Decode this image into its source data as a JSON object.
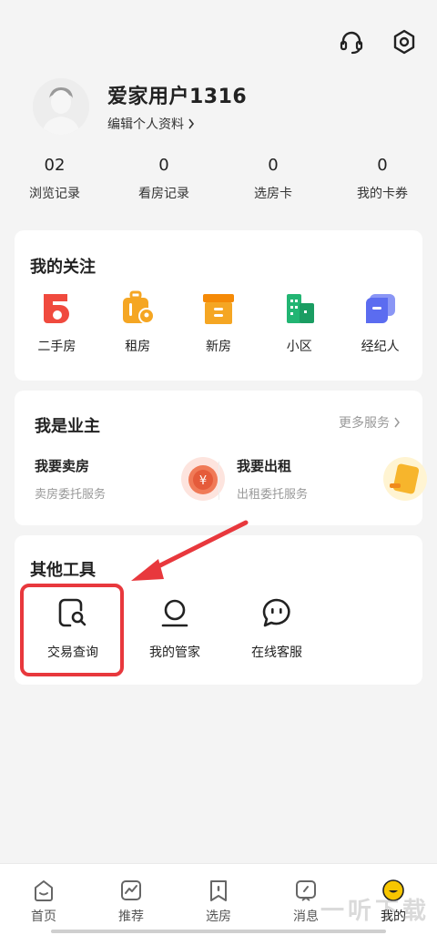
{
  "header": {
    "icons": [
      "headset-icon",
      "settings-icon"
    ]
  },
  "profile": {
    "username": "爱家用户1316",
    "edit_label": "编辑个人资料"
  },
  "stats": [
    {
      "value": "02",
      "label": "浏览记录"
    },
    {
      "value": "0",
      "label": "看房记录"
    },
    {
      "value": "0",
      "label": "选房卡"
    },
    {
      "value": "0",
      "label": "我的卡券"
    }
  ],
  "follow": {
    "title": "我的关注",
    "items": [
      {
        "label": "二手房",
        "icon": "secondhand-house-icon",
        "color": "#f04a3e"
      },
      {
        "label": "租房",
        "icon": "rent-luggage-icon",
        "color": "#f5a623"
      },
      {
        "label": "新房",
        "icon": "new-house-box-icon",
        "color": "#f5a623"
      },
      {
        "label": "小区",
        "icon": "community-building-icon",
        "color": "#22b573"
      },
      {
        "label": "经纪人",
        "icon": "agent-icon",
        "color": "#5b6cf0"
      }
    ]
  },
  "owner": {
    "title": "我是业主",
    "more": "更多服务",
    "sell": {
      "title": "我要卖房",
      "subtitle": "卖房委托服务"
    },
    "rent": {
      "title": "我要出租",
      "subtitle": "出租委托服务"
    }
  },
  "tools": {
    "title": "其他工具",
    "items": [
      {
        "label": "交易查询",
        "icon": "transaction-search-icon"
      },
      {
        "label": "我的管家",
        "icon": "butler-icon"
      },
      {
        "label": "在线客服",
        "icon": "chat-icon"
      }
    ]
  },
  "tabbar": {
    "tabs": [
      {
        "label": "首页",
        "icon": "home-icon"
      },
      {
        "label": "推荐",
        "icon": "recommend-icon"
      },
      {
        "label": "选房",
        "icon": "bookmark-icon"
      },
      {
        "label": "消息",
        "icon": "message-icon"
      },
      {
        "label": "我的",
        "icon": "profile-face-icon"
      }
    ],
    "active": "我的"
  },
  "colors": {
    "accent": "#f7c600",
    "highlight": "#e8383d"
  },
  "watermark": "一听下载"
}
